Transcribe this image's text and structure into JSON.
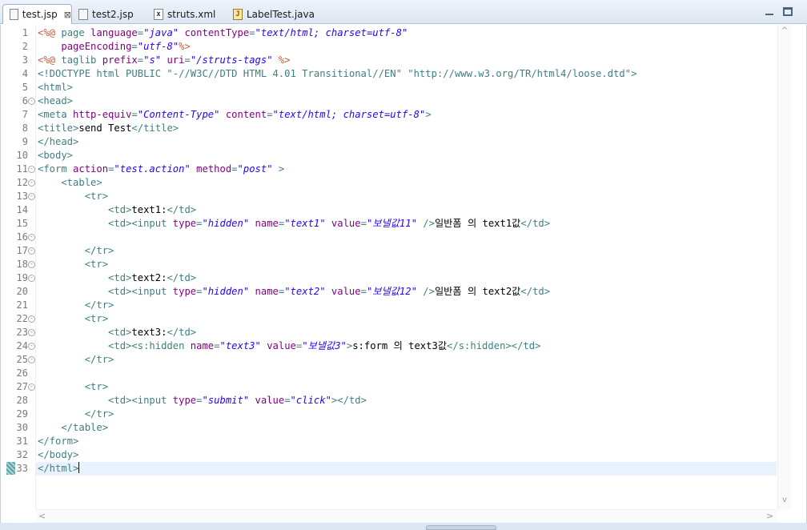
{
  "tabs": [
    {
      "label": "test.jsp",
      "icon": "jsp-file-icon",
      "active": true,
      "close": "⊠"
    },
    {
      "label": "test2.jsp",
      "icon": "jsp-file-icon",
      "active": false
    },
    {
      "label": "struts.xml",
      "icon": "xml-file-icon",
      "active": false
    },
    {
      "label": "LabelTest.java",
      "icon": "java-file-icon",
      "active": false
    }
  ],
  "window_controls": [
    "minimize-icon",
    "maximize-icon"
  ],
  "editor": {
    "current_line": 33,
    "fold_lines": [
      6,
      11,
      12,
      13,
      16,
      17,
      18,
      19,
      22,
      23,
      24,
      25,
      27
    ],
    "line_numbers": [
      "1",
      "2",
      "3",
      "4",
      "5",
      "6",
      "7",
      "8",
      "9",
      "10",
      "11",
      "12",
      "13",
      "14",
      "15",
      "16",
      "17",
      "18",
      "19",
      "20",
      "21",
      "22",
      "23",
      "24",
      "25",
      "26",
      "27",
      "28",
      "29",
      "30",
      "31",
      "32",
      "33"
    ],
    "lines": [
      [
        [
          "d",
          "<%@ "
        ],
        [
          "t",
          "page "
        ],
        [
          "a",
          "language"
        ],
        [
          "t",
          "="
        ],
        [
          "v",
          "\"java\" "
        ],
        [
          "a",
          "contentType"
        ],
        [
          "t",
          "="
        ],
        [
          "v",
          "\"text/html; charset=utf-8\""
        ]
      ],
      [
        [
          "t",
          "    "
        ],
        [
          "a",
          "pageEncoding"
        ],
        [
          "t",
          "="
        ],
        [
          "v",
          "\"utf-8\""
        ],
        [
          "d",
          "%>"
        ]
      ],
      [
        [
          "d",
          "<%@ "
        ],
        [
          "t",
          "taglib "
        ],
        [
          "a",
          "prefix"
        ],
        [
          "t",
          "="
        ],
        [
          "v",
          "\"s\" "
        ],
        [
          "a",
          "uri"
        ],
        [
          "t",
          "="
        ],
        [
          "v",
          "\"/struts-tags\" "
        ],
        [
          "d",
          "%>"
        ]
      ],
      [
        [
          "dt",
          "<!DOCTYPE html PUBLIC \"-//W3C//DTD HTML 4.01 Transitional//EN\" \"http://www.w3.org/TR/html4/loose.dtd\">"
        ]
      ],
      [
        [
          "t",
          "<html>"
        ]
      ],
      [
        [
          "t",
          "<head>"
        ]
      ],
      [
        [
          "t",
          "<meta "
        ],
        [
          "a",
          "http-equiv"
        ],
        [
          "t",
          "="
        ],
        [
          "v",
          "\"Content-Type\" "
        ],
        [
          "a",
          "content"
        ],
        [
          "t",
          "="
        ],
        [
          "v",
          "\"text/html; charset=utf-8\""
        ],
        [
          "t",
          ">"
        ]
      ],
      [
        [
          "t",
          "<title>"
        ],
        [
          "x",
          "send Test"
        ],
        [
          "t",
          "</title>"
        ]
      ],
      [
        [
          "t",
          "</head>"
        ]
      ],
      [
        [
          "t",
          "<body>"
        ]
      ],
      [
        [
          "t",
          "<form "
        ],
        [
          "a",
          "action"
        ],
        [
          "t",
          "="
        ],
        [
          "v",
          "\"test.action\" "
        ],
        [
          "a",
          "method"
        ],
        [
          "t",
          "="
        ],
        [
          "v",
          "\"post\" "
        ],
        [
          "t",
          ">"
        ]
      ],
      [
        [
          "t",
          "    <table>"
        ]
      ],
      [
        [
          "t",
          "        <tr>"
        ]
      ],
      [
        [
          "t",
          "            <td>"
        ],
        [
          "x",
          "text1:"
        ],
        [
          "t",
          "</td>"
        ]
      ],
      [
        [
          "t",
          "            <td><input "
        ],
        [
          "a",
          "type"
        ],
        [
          "t",
          "="
        ],
        [
          "v",
          "\"hidden\" "
        ],
        [
          "a",
          "name"
        ],
        [
          "t",
          "="
        ],
        [
          "v",
          "\"text1\" "
        ],
        [
          "a",
          "value"
        ],
        [
          "t",
          "="
        ],
        [
          "v",
          "\"보낼값11\" "
        ],
        [
          "t",
          "/>"
        ],
        [
          "x",
          "일반폼 의 text1값"
        ],
        [
          "t",
          "</td>"
        ]
      ],
      [
        [
          "x",
          ""
        ]
      ],
      [
        [
          "t",
          "        </tr>"
        ]
      ],
      [
        [
          "t",
          "        <tr>"
        ]
      ],
      [
        [
          "t",
          "            <td>"
        ],
        [
          "x",
          "text2:"
        ],
        [
          "t",
          "</td>"
        ]
      ],
      [
        [
          "t",
          "            <td><input "
        ],
        [
          "a",
          "type"
        ],
        [
          "t",
          "="
        ],
        [
          "v",
          "\"hidden\" "
        ],
        [
          "a",
          "name"
        ],
        [
          "t",
          "="
        ],
        [
          "v",
          "\"text2\" "
        ],
        [
          "a",
          "value"
        ],
        [
          "t",
          "="
        ],
        [
          "v",
          "\"보낼값12\" "
        ],
        [
          "t",
          "/>"
        ],
        [
          "x",
          "일반폼 의 text2값"
        ],
        [
          "t",
          "</td>"
        ]
      ],
      [
        [
          "t",
          "        </tr>"
        ]
      ],
      [
        [
          "t",
          "        <tr>"
        ]
      ],
      [
        [
          "t",
          "            <td>"
        ],
        [
          "x",
          "text3:"
        ],
        [
          "t",
          "</td>"
        ]
      ],
      [
        [
          "t",
          "            <td><s:hidden "
        ],
        [
          "a",
          "name"
        ],
        [
          "t",
          "="
        ],
        [
          "v",
          "\"text3\" "
        ],
        [
          "a",
          "value"
        ],
        [
          "t",
          "="
        ],
        [
          "v",
          "\"보낼값3\""
        ],
        [
          "t",
          ">"
        ],
        [
          "x",
          "s:form 의 text3값"
        ],
        [
          "t",
          "</s:hidden></td>"
        ]
      ],
      [
        [
          "t",
          "        </tr>"
        ]
      ],
      [
        [
          "x",
          ""
        ]
      ],
      [
        [
          "t",
          "        <tr>"
        ]
      ],
      [
        [
          "t",
          "            <td><input "
        ],
        [
          "a",
          "type"
        ],
        [
          "t",
          "="
        ],
        [
          "v",
          "\"submit\" "
        ],
        [
          "a",
          "value"
        ],
        [
          "t",
          "="
        ],
        [
          "v",
          "\"click\""
        ],
        [
          "t",
          "></td>"
        ]
      ],
      [
        [
          "t",
          "        </tr>"
        ]
      ],
      [
        [
          "t",
          "    </table>"
        ]
      ],
      [
        [
          "t",
          "</form>"
        ]
      ],
      [
        [
          "t",
          "</body>"
        ]
      ],
      [
        [
          "t",
          "</html>"
        ]
      ]
    ]
  },
  "colors": {
    "tag": "#3f7f7f",
    "attribute": "#7f007f",
    "value": "#2a00ff",
    "directive": "#bf5f3f",
    "current_line": "#e8f2fe"
  }
}
